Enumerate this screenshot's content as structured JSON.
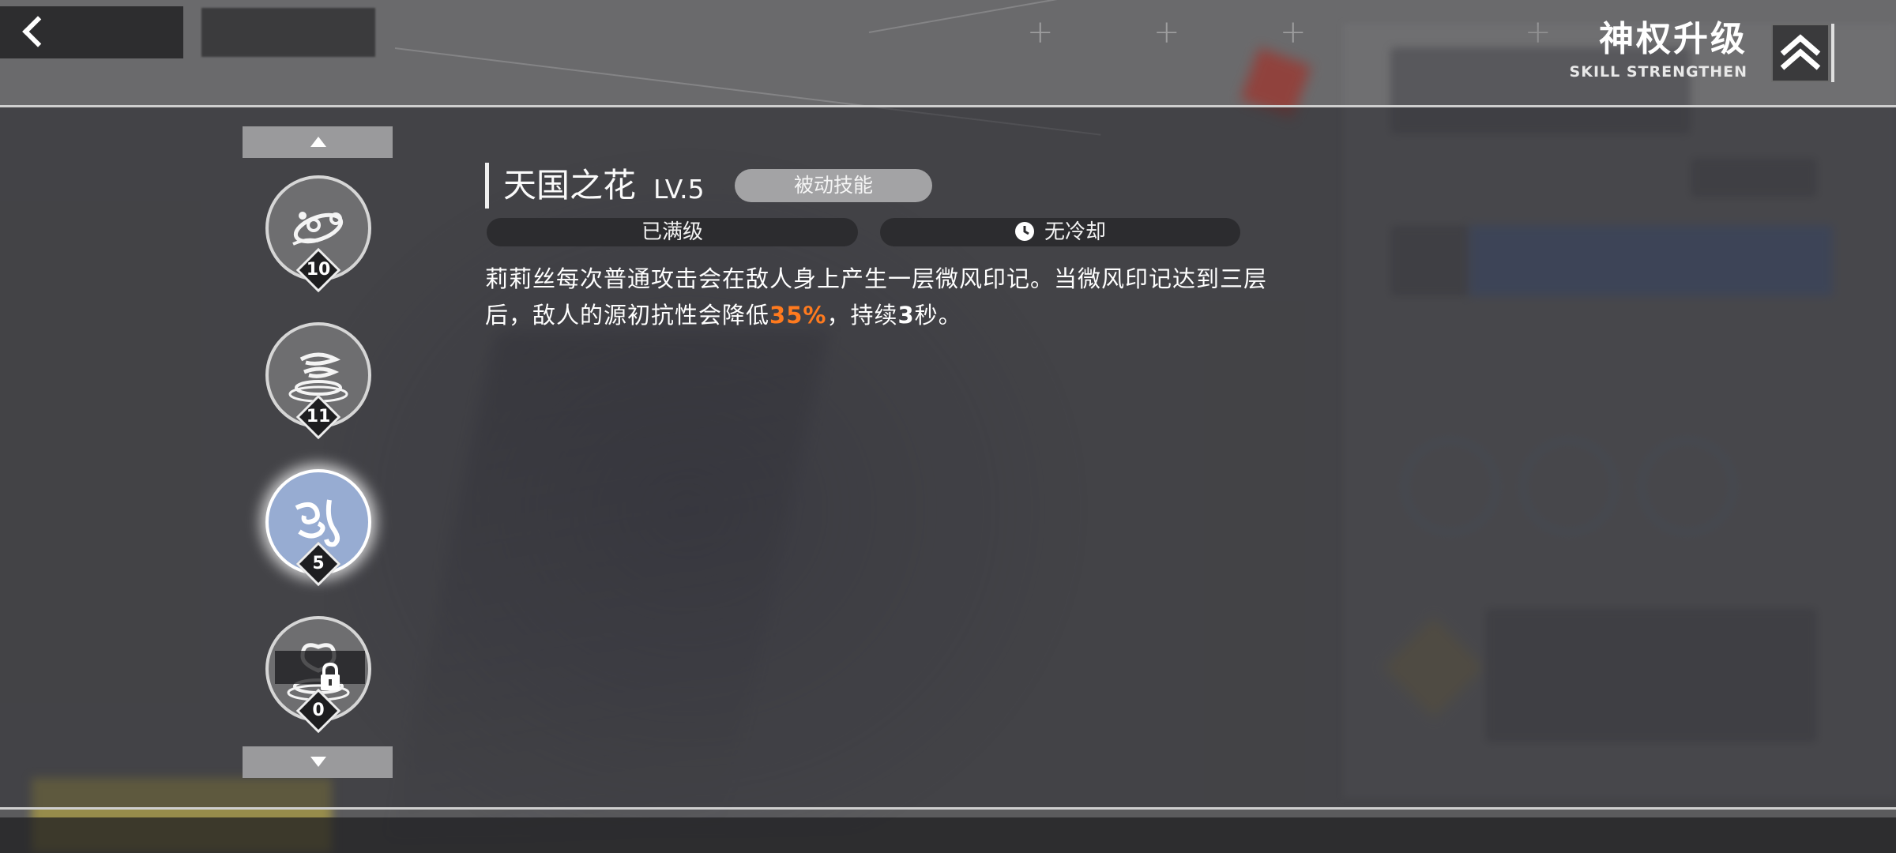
{
  "header": {
    "title": "神权升级",
    "subtitle": "SKILL STRENGTHEN",
    "back_icon": "chevron-left-icon",
    "title_icon": "double-chevron-up-icon"
  },
  "skill_list": {
    "scroll_up_icon": "triangle-up-icon",
    "scroll_down_icon": "triangle-down-icon",
    "skills": [
      {
        "icon": "orbit-rings-icon",
        "level": "10",
        "selected": false,
        "locked": false
      },
      {
        "icon": "whirlwind-icon",
        "level": "11",
        "selected": false,
        "locked": false
      },
      {
        "icon": "wind-swirl-icon",
        "level": "5",
        "selected": true,
        "locked": false
      },
      {
        "icon": "fountain-icon",
        "level": "0",
        "selected": false,
        "locked": true
      }
    ]
  },
  "detail": {
    "name": "天国之花",
    "level": "LV.5",
    "type": "被动技能",
    "status": "已满级",
    "cooldown": "无冷却",
    "description": {
      "part1": "莉莉丝每次普通攻击会在敌人身上产生一层微风印记。当微风印记达到三层后，敌人的源初抗性会降低",
      "highlight": "35%",
      "part2": "，持续",
      "duration": "3",
      "part3": "秒。"
    }
  },
  "colors": {
    "highlight": "#ff7a1e",
    "selected_skill": "#97acd2",
    "panel_dark": "#2c2c2f"
  }
}
